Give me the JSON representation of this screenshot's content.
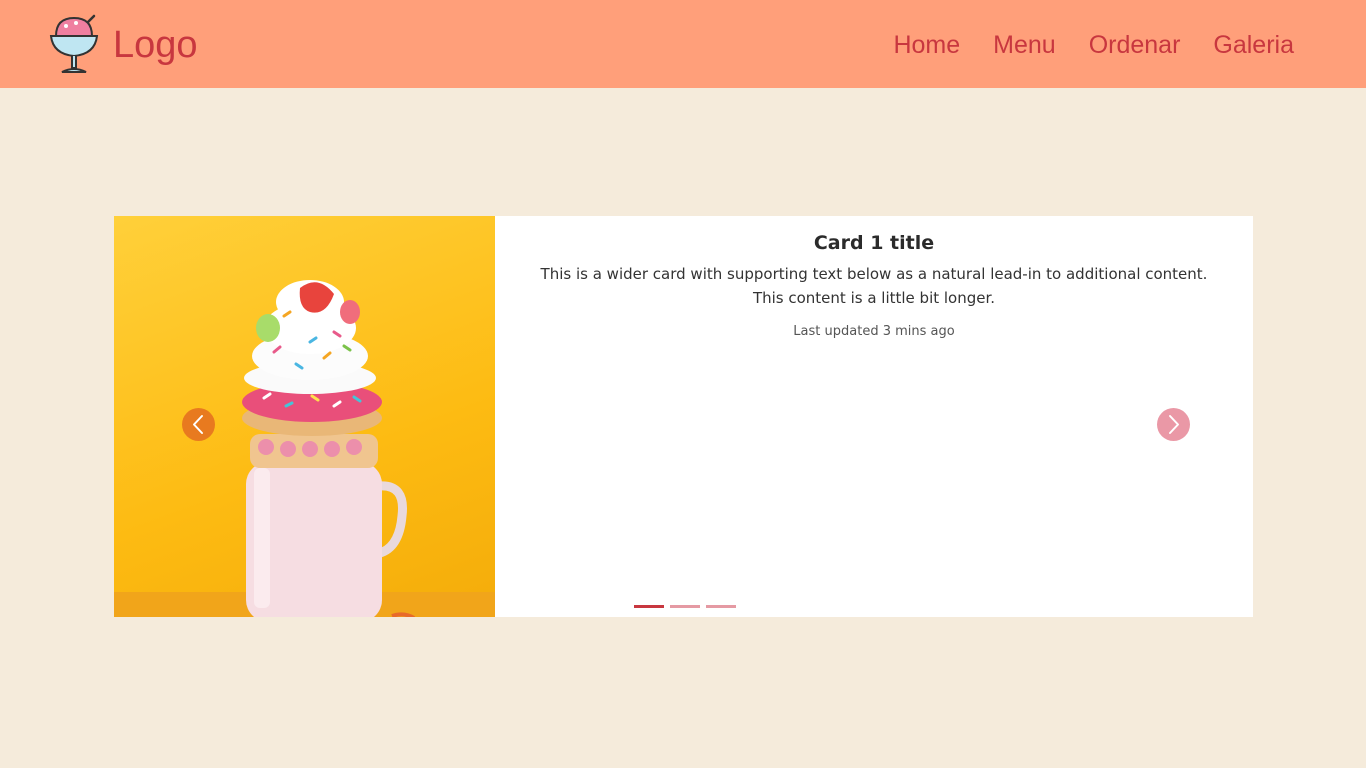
{
  "header": {
    "logo_text": "Logo",
    "logo_icon": "ice-cream-sundae-icon",
    "nav": [
      {
        "label": "Home"
      },
      {
        "label": "Menu"
      },
      {
        "label": "Ordenar"
      },
      {
        "label": "Galeria"
      }
    ]
  },
  "carousel": {
    "card": {
      "title": "Card 1 title",
      "text": "This is a wider card with supporting text below as a natural lead-in to additional content. This content is a little bit longer.",
      "updated": "Last updated 3 mins ago",
      "image_subject": "freakshake-milkshake-photo"
    },
    "prev_icon": "chevron-left-icon",
    "next_icon": "chevron-right-icon",
    "slide_count": 3,
    "active_slide": 1
  },
  "colors": {
    "navbar": "#ff9f7a",
    "brand_text": "#c8373f",
    "page_background": "#f5ebdb",
    "image_background": "#fdbb12",
    "prev_arrow": "#e87a1f",
    "next_arrow": "#ea98a6"
  }
}
